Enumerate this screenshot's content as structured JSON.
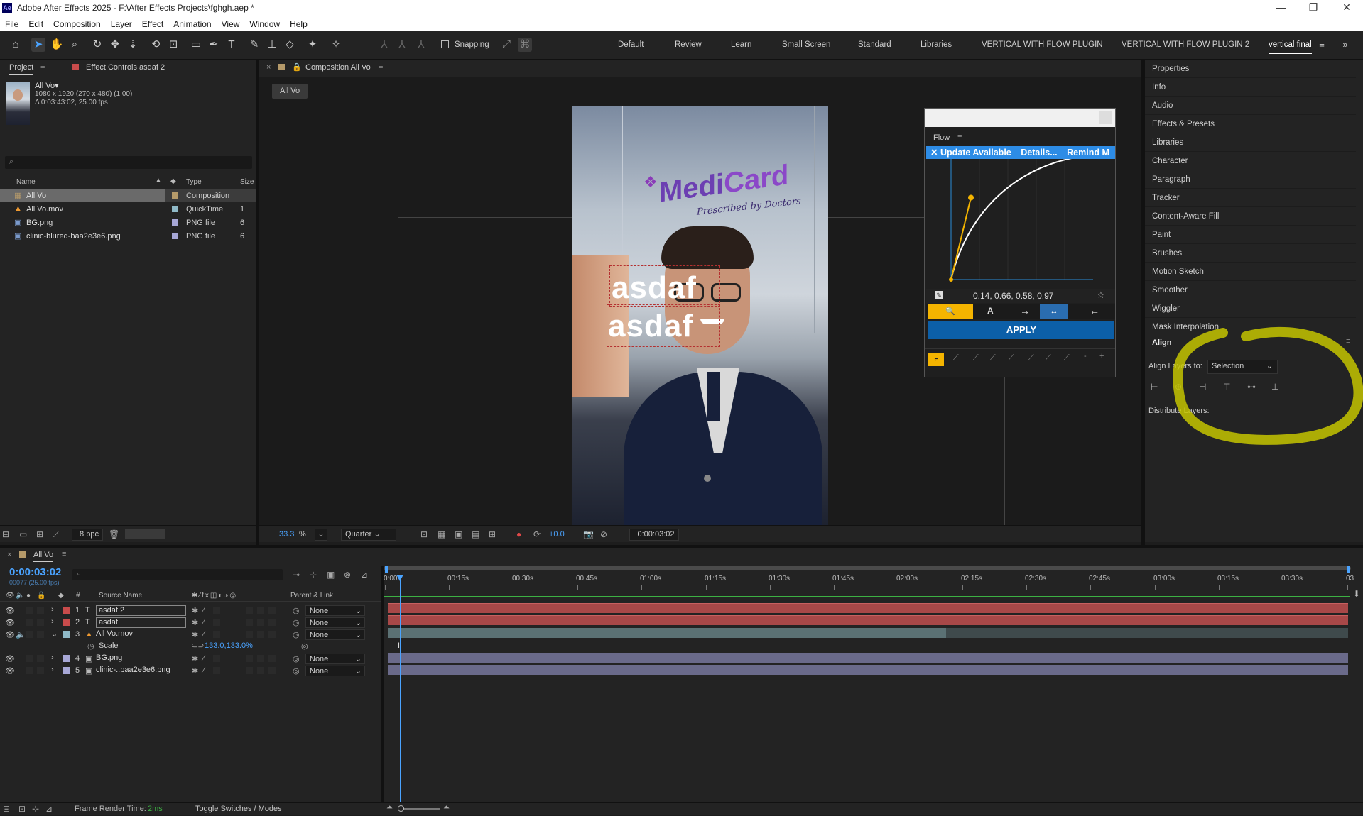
{
  "titlebar": {
    "title": "Adobe After Effects 2025 - F:\\After Effects Projects\\fghgh.aep *",
    "app_icon": "Ae",
    "minimize": "—",
    "maximize": "❐",
    "close": "✕"
  },
  "menu": [
    "File",
    "Edit",
    "Composition",
    "Layer",
    "Effect",
    "Animation",
    "View",
    "Window",
    "Help"
  ],
  "toolbar": {
    "snapping_label": "Snapping"
  },
  "workspaces": [
    "Default",
    "Review",
    "Learn",
    "Small Screen",
    "Standard",
    "Libraries",
    "VERTICAL WITH FLOW PLUGIN",
    "VERTICAL WITH FLOW PLUGIN 2",
    "vertical final"
  ],
  "project": {
    "tab_project": "Project",
    "tab_effect_controls": "Effect Controls asdaf 2",
    "item_name": "All Vo▾",
    "item_info1": "1080 x 1920  (270 x 480) (1.00)",
    "item_info2": "Δ 0:03:43:02, 25.00 fps",
    "search_placeholder": "",
    "col_name": "Name",
    "col_type": "Type",
    "col_size": "Size",
    "items": [
      {
        "name": "All Vo",
        "type": "Composition",
        "size": "",
        "color": "#b59a6a",
        "icon": "comp-icon"
      },
      {
        "name": "All Vo.mov",
        "type": "QuickTime",
        "size": "1",
        "color": "#8fb9c7",
        "icon": "warning-icon"
      },
      {
        "name": "BG.png",
        "type": "PNG file",
        "size": "6",
        "color": "#a7a7d6",
        "icon": "image-icon"
      },
      {
        "name": "clinic-blured-baa2e3e6.png",
        "type": "PNG file",
        "size": "6",
        "color": "#a7a7d6",
        "icon": "image-icon"
      }
    ],
    "bpc": "8 bpc"
  },
  "composition": {
    "tab_label": "Composition All Vo",
    "breadcrumb": "All Vo",
    "zoom": "33.3",
    "zoom_unit": "%",
    "resolution": "Quarter",
    "exposure": "+0.0",
    "timecode": "0:00:03:02",
    "logo_text_medi": "Medi",
    "logo_text_card": "Card",
    "logo_tagline": "Prescribed by Doctors",
    "text_layer_1": "asdaf",
    "text_layer_2": "asdaf"
  },
  "flow": {
    "title": "Flow",
    "update_text": "✕ Update Available",
    "details": "Details...",
    "remind": "Remind M",
    "values": "0.14, 0.66, 0.58, 0.97",
    "apply": "APPLY",
    "curve": {
      "p1": [
        0.14,
        0.66
      ],
      "p2": [
        0.58,
        0.97
      ]
    }
  },
  "right_panel": {
    "items": [
      "Properties",
      "Info",
      "Audio",
      "Effects & Presets",
      "Libraries",
      "Character",
      "Paragraph",
      "Tracker",
      "Content-Aware Fill",
      "Paint",
      "Brushes",
      "Motion Sketch",
      "Smoother",
      "Wiggler",
      "Mask Interpolation"
    ],
    "align_title": "Align",
    "align_to_label": "Align Layers to:",
    "align_to_value": "Selection",
    "distribute_label": "Distribute Layers:"
  },
  "timeline": {
    "tab": "All Vo",
    "timecode": "0:00:03:02",
    "frame_info": "00077 (25.00 fps)",
    "col_source": "Source Name",
    "col_parent": "Parent & Link",
    "ruler": [
      "0:00s",
      "00:15s",
      "00:30s",
      "00:45s",
      "01:00s",
      "01:15s",
      "01:30s",
      "01:45s",
      "02:00s",
      "02:15s",
      "02:30s",
      "02:45s",
      "03:00s",
      "03:15s",
      "03:30s",
      "03"
    ],
    "layers": [
      {
        "num": "1",
        "name": "asdaf 2",
        "type": "T",
        "parent": "None",
        "color": "#c84b4b"
      },
      {
        "num": "2",
        "name": "asdaf",
        "type": "T",
        "parent": "None",
        "color": "#c84b4b"
      },
      {
        "num": "3",
        "name": "All Vo.mov",
        "type": "▲",
        "parent": "None",
        "color": "#8fb9c7"
      },
      {
        "num": "4",
        "name": "BG.png",
        "type": "▣",
        "parent": "None",
        "color": "#a7a7d6"
      },
      {
        "num": "5",
        "name": "clinic-..baa2e3e6.png",
        "type": "▣",
        "parent": "None",
        "color": "#a7a7d6"
      }
    ],
    "scale_label": "Scale",
    "scale_value": "133.0,133.0%",
    "render_time_label": "Frame Render Time:",
    "render_time_value": "2ms",
    "toggle_label": "Toggle Switches / Modes"
  }
}
